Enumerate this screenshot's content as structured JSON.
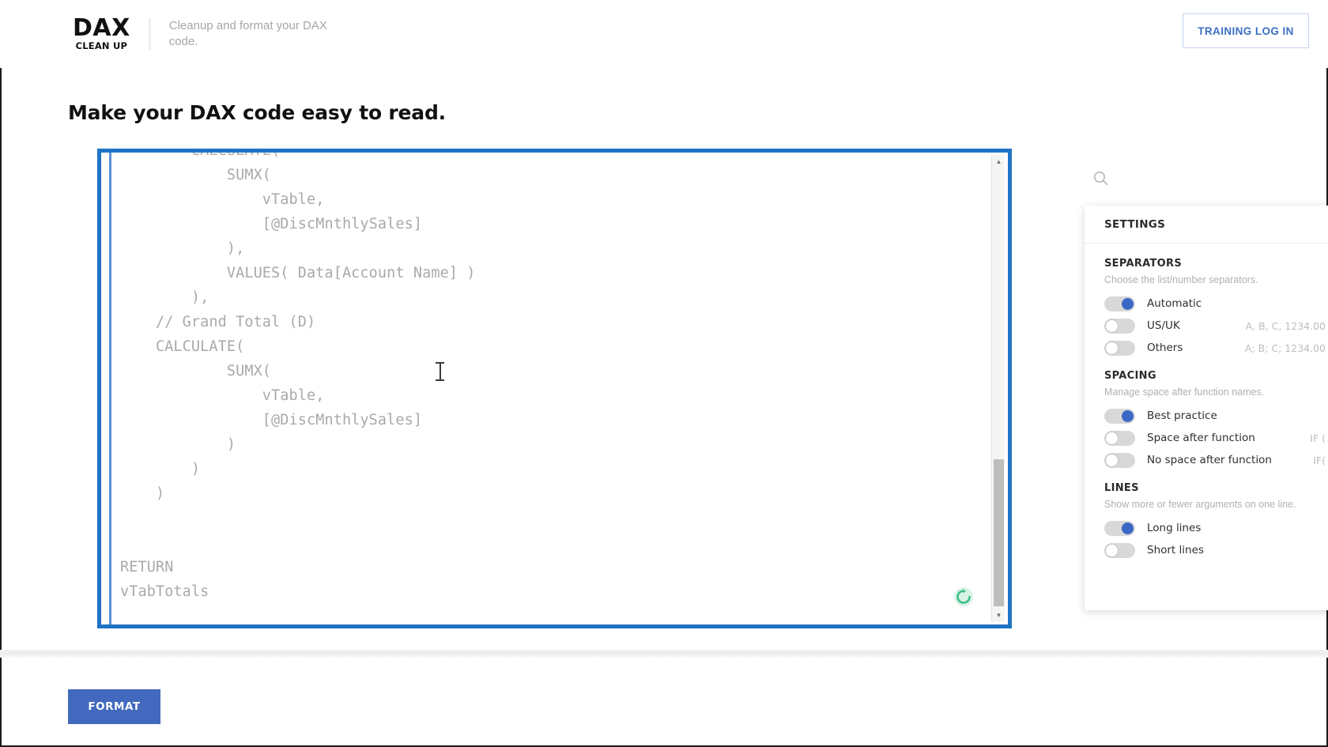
{
  "header": {
    "logo_primary": "DAX",
    "logo_secondary": "CLEAN UP",
    "tagline": "Cleanup and format your DAX code.",
    "login_label": "TRAINING LOG IN"
  },
  "page": {
    "title": "Make your DAX code easy to read."
  },
  "editor": {
    "code": "        CALCULATE(\n            SUMX(\n                vTable,\n                [@DiscMnthlySales]\n            ),\n            VALUES( Data[Account Name] )\n        ),\n    // Grand Total (D)\n    CALCULATE(\n            SUMX(\n                vTable,\n                [@DiscMnthlySales]\n            )\n        )\n    )\n\n\nRETURN\nvTabTotals",
    "refresh_icon": "refresh-icon",
    "scrollbar_up": "▲",
    "scrollbar_down": "▼"
  },
  "search": {
    "icon": "search-icon"
  },
  "settings": {
    "title": "SETTINGS",
    "groups": [
      {
        "title": "SEPARATORS",
        "description": "Choose the list/number separators.",
        "options": [
          {
            "label": "Automatic",
            "hint": "",
            "on": true
          },
          {
            "label": "US/UK",
            "hint": "A, B, C, 1234.00",
            "on": false
          },
          {
            "label": "Others",
            "hint": "A; B; C; 1234.00",
            "on": false
          }
        ]
      },
      {
        "title": "SPACING",
        "description": "Manage space after function names.",
        "options": [
          {
            "label": "Best practice",
            "hint": "",
            "on": true
          },
          {
            "label": "Space after function",
            "hint": "IF (",
            "on": false
          },
          {
            "label": "No space after function",
            "hint": "IF(",
            "on": false
          }
        ]
      },
      {
        "title": "LINES",
        "description": "Show more or fewer arguments on one line.",
        "options": [
          {
            "label": "Long lines",
            "hint": "",
            "on": true
          },
          {
            "label": "Short lines",
            "hint": "",
            "on": false
          }
        ]
      }
    ]
  },
  "footer": {
    "format_label": "FORMAT"
  },
  "colors": {
    "accent_blue": "#1f73c4",
    "button_blue": "#4269bd",
    "toggle_on": "#3a68c4",
    "refresh_green": "#4ac48a",
    "code_text": "#a9a9a9"
  }
}
